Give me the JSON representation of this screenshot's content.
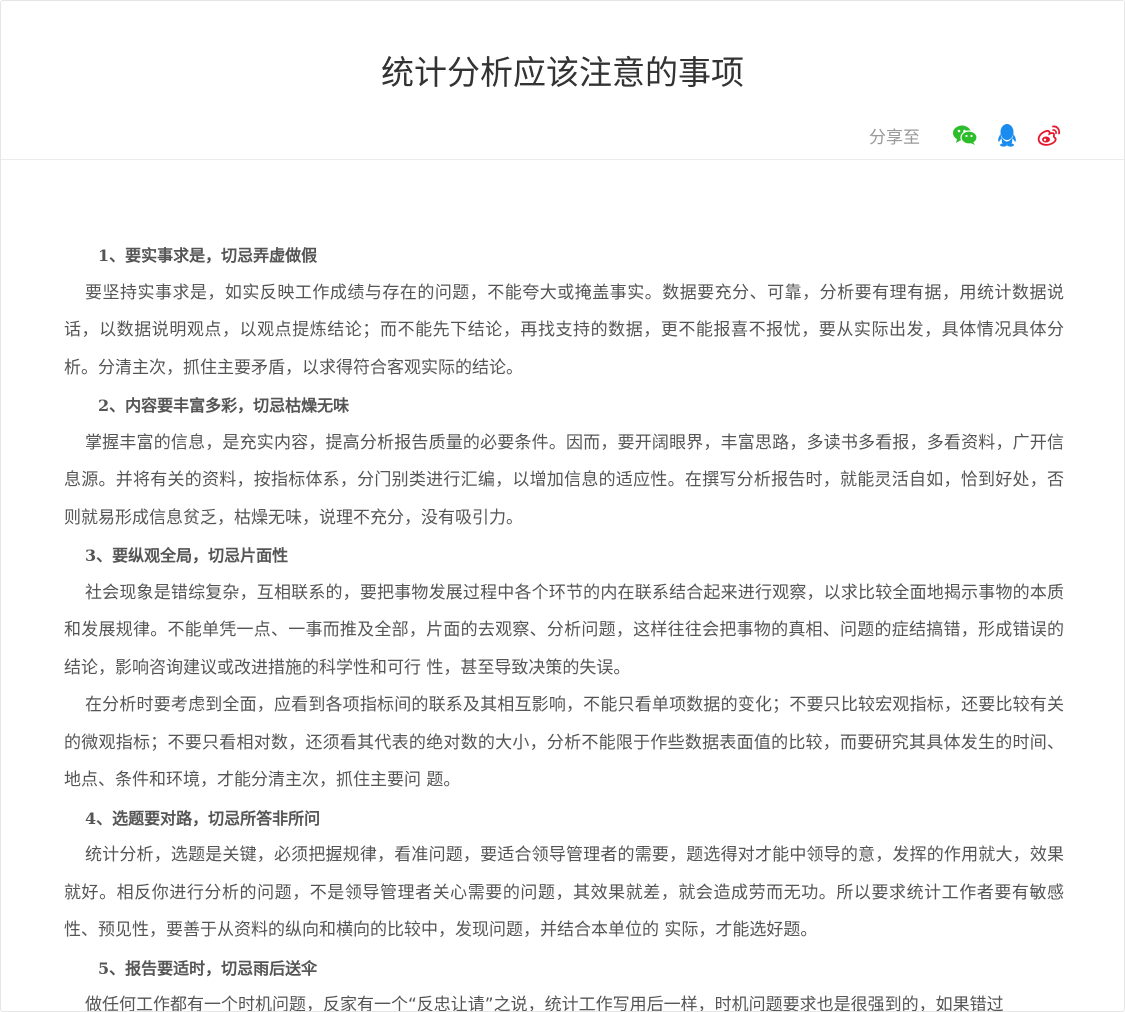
{
  "article": {
    "title": "统计分析应该注意的事项",
    "share_label": "分享至",
    "share_icons": [
      "wechat-icon",
      "qq-icon",
      "weibo-icon"
    ],
    "colors": {
      "wechat": "#2dbd2a",
      "qq": "#1a8cf0",
      "weibo": "#e6162d",
      "text": "#555555",
      "title": "#333333"
    }
  },
  "sections": {
    "s1": {
      "heading": "1、要实事求是，切忌弄虚做假",
      "p1": "要坚持实事求是，如实反映工作成绩与存在的问题，不能夸大或掩盖事实。数据要充分、可靠，分析要有理有据，用统计数据说话，以数据说明观点，以观点提炼结论；而不能先下结论，再找支持的数据，更不能报喜不报忧，要从实际出发，具体情况具体分析。分清主次，抓住主要矛盾，以求得符合客观实际的结论。"
    },
    "s2": {
      "heading": "2、内容要丰富多彩，切忌枯燥无味",
      "p1": "掌握丰富的信息，是充实内容，提高分析报告质量的必要条件。因而，要开阔眼界，丰富思路，多读书多看报，多看资料，广开信息源。并将有关的资料，按指标体系，分门别类进行汇编，以增加信息的适应性。在撰写分析报告时，就能灵活自如，恰到好处，否则就易形成信息贫乏，枯燥无味，说理不充分，没有吸引力。"
    },
    "s3": {
      "heading": "3、要纵观全局，切忌片面性",
      "p1": "社会现象是错综复杂，互相联系的，要把事物发展过程中各个环节的内在联系结合起来进行观察，以求比较全面地揭示事物的本质和发展规律。不能单凭一点、一事而推及全部，片面的去观察、分析问题，这样往往会把事物的真相、问题的症结搞错，形成错误的结论，影响咨询建议或改进措施的科学性和可行 性，甚至导致决策的失误。",
      "p2": "在分析时要考虑到全面，应看到各项指标间的联系及其相互影响，不能只看单项数据的变化；不要只比较宏观指标，还要比较有关的微观指标；不要只看相对数，还须看其代表的绝对数的大小，分析不能限于作些数据表面值的比较，而要研究其具体发生的时间、地点、条件和环境，才能分清主次，抓住主要问 题。"
    },
    "s4": {
      "heading": "4、选题要对路，切忌所答非所问",
      "p1": "统计分析，选题是关键，必须把握规律，看准问题，要适合领导管理者的需要，题选得对才能中领导的意，发挥的作用就大，效果就好。相反你进行分析的问题，不是领导管理者关心需要的问题，其效果就差，就会造成劳而无功。所以要求统计工作者要有敏感性、预见性，要善于从资料的纵向和横向的比较中，发现问题，并结合本单位的 实际，才能选好题。"
    },
    "s5": {
      "heading": "5、报告要适时，切忌雨后送伞",
      "p1": "做任何工作都有一个时机问题，反家有一个“反忠让请”之说，统计工作写用后一样，时机问题要求也是很强到的，如果错过"
    }
  }
}
